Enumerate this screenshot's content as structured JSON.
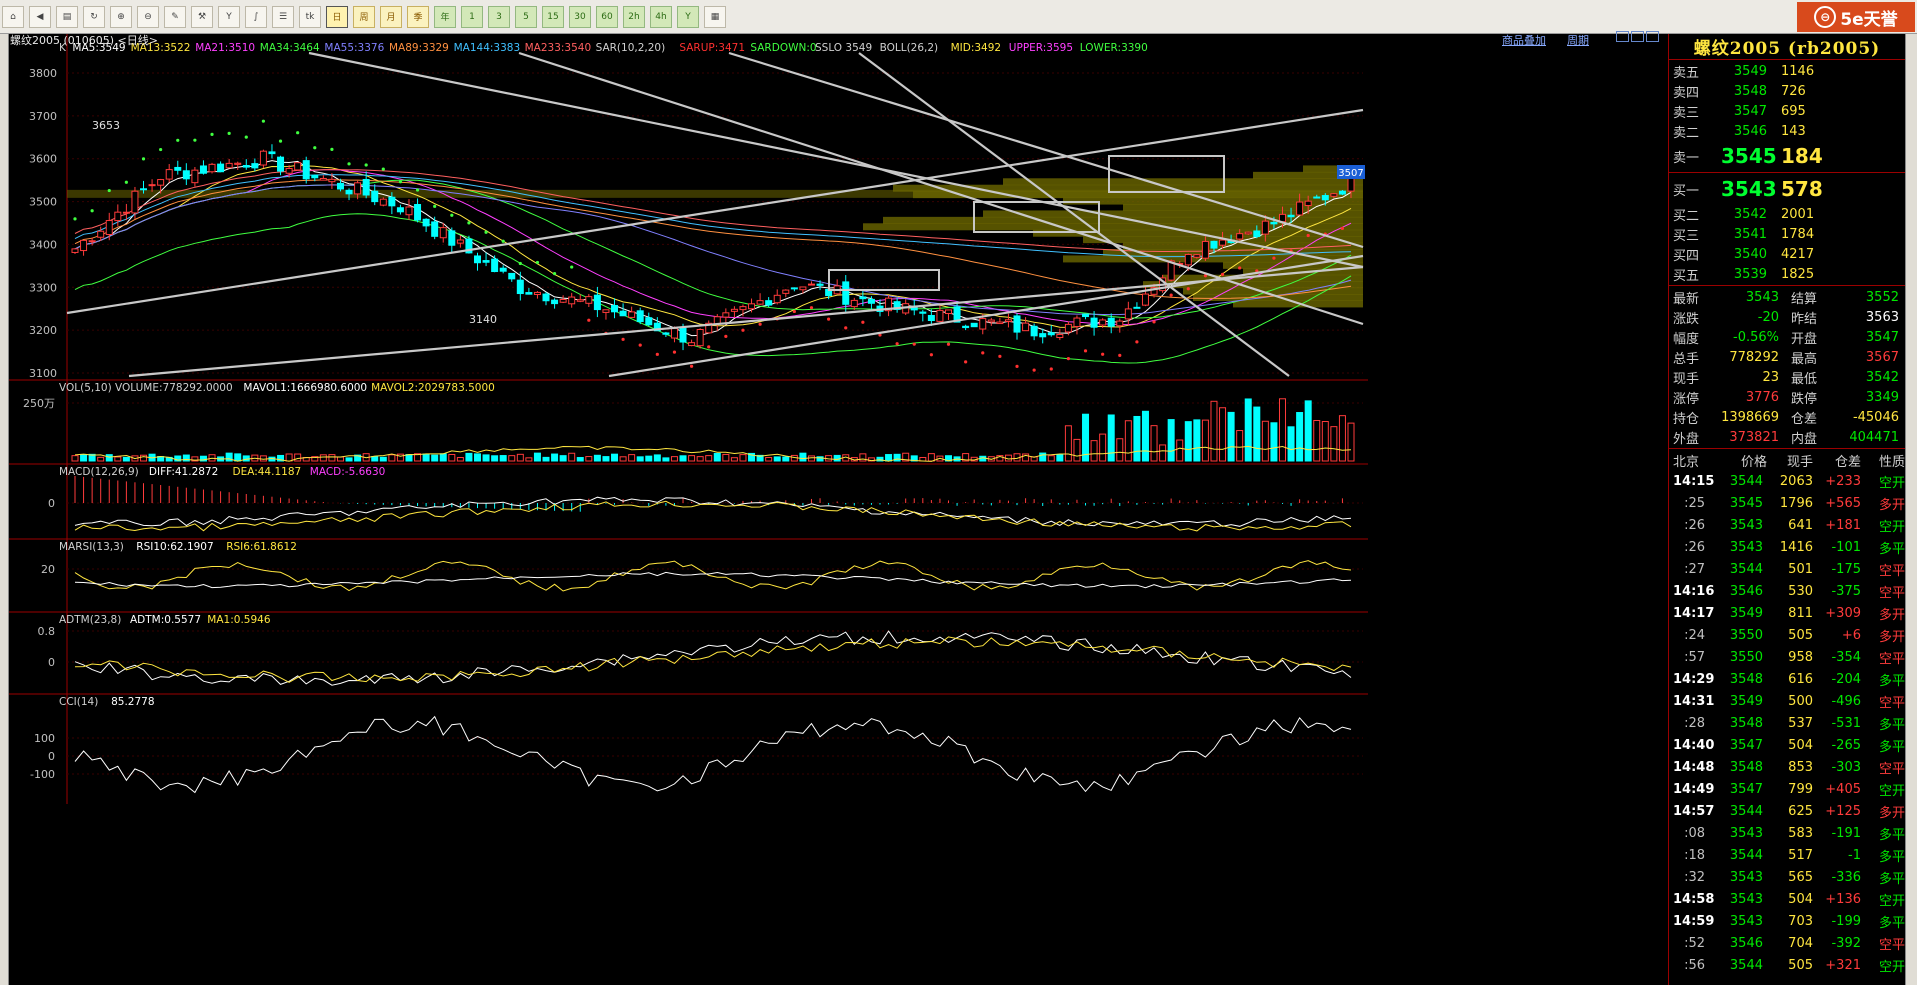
{
  "toolbar": {
    "buttons": [
      {
        "name": "home-icon",
        "glyph": "⌂"
      },
      {
        "name": "back-icon",
        "glyph": "◀"
      },
      {
        "name": "news-icon",
        "glyph": "▤"
      },
      {
        "name": "refresh-icon",
        "glyph": "↻"
      },
      {
        "name": "zoom-in-icon",
        "glyph": "⊕"
      },
      {
        "name": "zoom-out-icon",
        "glyph": "⊖"
      },
      {
        "name": "draw-icon",
        "glyph": "✎"
      },
      {
        "name": "tools-icon",
        "glyph": "⚒"
      },
      {
        "name": "indicator-icon",
        "glyph": "Y"
      },
      {
        "name": "formula-icon",
        "glyph": "∫"
      },
      {
        "name": "list-icon",
        "glyph": "☰"
      },
      {
        "name": "tick-chart-icon",
        "glyph": "tk"
      }
    ],
    "periods": [
      "日",
      "周",
      "月",
      "季",
      "年",
      "1",
      "3",
      "5",
      "15",
      "30",
      "60",
      "2h",
      "4h",
      "Y"
    ],
    "selected_period": "日",
    "logo_text": "5e天誉"
  },
  "window": {
    "title": "螺纹2005 (010605) <日线>",
    "links": [
      "商品叠加",
      "周期"
    ]
  },
  "main_chart": {
    "legend": [
      {
        "text": "K",
        "color": "#d0d0d0"
      },
      {
        "text": "MA5:3549",
        "color": "#ffffff"
      },
      {
        "text": "MA13:3522",
        "color": "#ffe640"
      },
      {
        "text": "MA21:3510",
        "color": "#ff40ff"
      },
      {
        "text": "MA34:3464",
        "color": "#40ff40"
      },
      {
        "text": "MA55:3376",
        "color": "#8080ff"
      },
      {
        "text": "MA89:3329",
        "color": "#ff9040"
      },
      {
        "text": "MA144:3383",
        "color": "#40c0ff"
      },
      {
        "text": "MA233:3540",
        "color": "#ff6060"
      },
      {
        "text": "SAR(10,2,20)",
        "color": "#d0d0d0"
      },
      {
        "text": "SARUP:3471",
        "color": "#ff3030"
      },
      {
        "text": "SARDOWN:0",
        "color": "#40ff40"
      },
      {
        "text": "SSLO 3549",
        "color": "#d0d0d0"
      },
      {
        "text": "BOLL(26,2)",
        "color": "#d0d0d0"
      },
      {
        "text": "MID:3492",
        "color": "#ffe640"
      },
      {
        "text": "UPPER:3595",
        "color": "#ff40ff"
      },
      {
        "text": "LOWER:3390",
        "color": "#40ff40"
      }
    ],
    "y_ticks": [
      "3800",
      "3700",
      "3600",
      "3500",
      "3400",
      "3300",
      "3200",
      "3100"
    ],
    "annotations": {
      "high": "3653",
      "low": "3140",
      "price_flag": "3507"
    }
  },
  "panels": [
    {
      "id": "vol",
      "legend": [
        {
          "text": "VOL(5,10) VOLUME:778292.0000",
          "color": "#d0d0d0"
        },
        {
          "text": "MAVOL1:1666980.6000",
          "color": "#ffffff"
        },
        {
          "text": "MAVOL2:2029783.5000",
          "color": "#ffe640"
        }
      ],
      "ticks": [
        "250万"
      ]
    },
    {
      "id": "macd",
      "legend": [
        {
          "text": "MACD(12,26,9)",
          "color": "#d0d0d0"
        },
        {
          "text": "DIFF:41.2872",
          "color": "#ffffff"
        },
        {
          "text": "DEA:44.1187",
          "color": "#ffe640"
        },
        {
          "text": "MACD:-5.6630",
          "color": "#ff40ff"
        }
      ],
      "ticks": [
        "0"
      ]
    },
    {
      "id": "rsi",
      "legend": [
        {
          "text": "MARSI(13,3)",
          "color": "#d0d0d0"
        },
        {
          "text": "RSI10:62.1907",
          "color": "#ffffff"
        },
        {
          "text": "RSI6:61.8612",
          "color": "#ffe640"
        }
      ],
      "ticks": [
        "20"
      ]
    },
    {
      "id": "adtm",
      "legend": [
        {
          "text": "ADTM(23,8)",
          "color": "#d0d0d0"
        },
        {
          "text": "ADTM:0.5577",
          "color": "#ffffff"
        },
        {
          "text": "MA1:0.5946",
          "color": "#ffe640"
        }
      ],
      "ticks": [
        "0.8",
        "0"
      ]
    },
    {
      "id": "cci",
      "legend": [
        {
          "text": "CCI(14)",
          "color": "#d0d0d0"
        },
        {
          "text": "85.2778",
          "color": "#ffffff"
        }
      ],
      "ticks": [
        "100",
        "0",
        "-100"
      ]
    }
  ],
  "quote": {
    "title": "螺纹2005 (rb2005)",
    "asks": [
      {
        "label": "卖五",
        "price": "3549",
        "vol": "1146"
      },
      {
        "label": "卖四",
        "price": "3548",
        "vol": "726"
      },
      {
        "label": "卖三",
        "price": "3547",
        "vol": "695"
      },
      {
        "label": "卖二",
        "price": "3546",
        "vol": "143"
      }
    ],
    "ask1": {
      "label": "卖一",
      "price": "3545",
      "vol": "184"
    },
    "bid1": {
      "label": "买一",
      "price": "3543",
      "vol": "578"
    },
    "bids": [
      {
        "label": "买二",
        "price": "3542",
        "vol": "2001"
      },
      {
        "label": "买三",
        "price": "3541",
        "vol": "1784"
      },
      {
        "label": "买四",
        "price": "3540",
        "vol": "4217"
      },
      {
        "label": "买五",
        "price": "3539",
        "vol": "1825"
      }
    ],
    "stats": [
      {
        "l1": "最新",
        "v1": "3543",
        "c1": "green",
        "l2": "结算",
        "v2": "3552",
        "c2": "green"
      },
      {
        "l1": "涨跌",
        "v1": "-20",
        "c1": "green",
        "l2": "昨结",
        "v2": "3563",
        "c2": "white"
      },
      {
        "l1": "幅度",
        "v1": "-0.56%",
        "c1": "green",
        "l2": "开盘",
        "v2": "3547",
        "c2": "green"
      },
      {
        "l1": "总手",
        "v1": "778292",
        "c1": "yellow",
        "l2": "最高",
        "v2": "3567",
        "c2": "red"
      },
      {
        "l1": "现手",
        "v1": "23",
        "c1": "yellow",
        "l2": "最低",
        "v2": "3542",
        "c2": "green"
      },
      {
        "l1": "涨停",
        "v1": "3776",
        "c1": "red",
        "l2": "跌停",
        "v2": "3349",
        "c2": "green"
      },
      {
        "l1": "持仓",
        "v1": "1398669",
        "c1": "yellow",
        "l2": "仓差",
        "v2": "-45046",
        "c2": "yellow"
      },
      {
        "l1": "外盘",
        "v1": "373821",
        "c1": "red",
        "l2": "内盘",
        "v2": "404471",
        "c2": "green"
      }
    ],
    "ticks_header": [
      "北京",
      "价格",
      "现手",
      "仓差",
      "性质"
    ],
    "ticks": [
      {
        "time": "14:15",
        "price": "3544",
        "vol": "2063",
        "diff": "+233",
        "nature": "空开",
        "nc": "green",
        "main": true
      },
      {
        "time": ":25",
        "price": "3545",
        "vol": "1796",
        "diff": "+565",
        "nature": "多开",
        "nc": "red",
        "main": false
      },
      {
        "time": ":26",
        "price": "3543",
        "vol": "641",
        "diff": "+181",
        "nature": "空开",
        "nc": "green",
        "main": false
      },
      {
        "time": ":26",
        "price": "3543",
        "vol": "1416",
        "diff": "-101",
        "nature": "多平",
        "nc": "green",
        "main": false
      },
      {
        "time": ":27",
        "price": "3544",
        "vol": "501",
        "diff": "-175",
        "nature": "空平",
        "nc": "red",
        "main": false
      },
      {
        "time": "14:16",
        "price": "3546",
        "vol": "530",
        "diff": "-375",
        "nature": "空平",
        "nc": "red",
        "main": true
      },
      {
        "time": "14:17",
        "price": "3549",
        "vol": "811",
        "diff": "+309",
        "nature": "多开",
        "nc": "red",
        "main": true
      },
      {
        "time": ":24",
        "price": "3550",
        "vol": "505",
        "diff": "+6",
        "nature": "多开",
        "nc": "red",
        "main": false
      },
      {
        "time": ":57",
        "price": "3550",
        "vol": "958",
        "diff": "-354",
        "nature": "空平",
        "nc": "red",
        "main": false
      },
      {
        "time": "14:29",
        "price": "3548",
        "vol": "616",
        "diff": "-204",
        "nature": "多平",
        "nc": "green",
        "main": true
      },
      {
        "time": "14:31",
        "price": "3549",
        "vol": "500",
        "diff": "-496",
        "nature": "空平",
        "nc": "red",
        "main": true
      },
      {
        "time": ":28",
        "price": "3548",
        "vol": "537",
        "diff": "-531",
        "nature": "多平",
        "nc": "green",
        "main": false
      },
      {
        "time": "14:40",
        "price": "3547",
        "vol": "504",
        "diff": "-265",
        "nature": "多平",
        "nc": "green",
        "main": true
      },
      {
        "time": "14:48",
        "price": "3548",
        "vol": "853",
        "diff": "-303",
        "nature": "空平",
        "nc": "red",
        "main": true
      },
      {
        "time": "14:49",
        "price": "3547",
        "vol": "799",
        "diff": "+405",
        "nature": "空开",
        "nc": "green",
        "main": true
      },
      {
        "time": "14:57",
        "price": "3544",
        "vol": "625",
        "diff": "+125",
        "nature": "多开",
        "nc": "red",
        "main": true
      },
      {
        "time": ":08",
        "price": "3543",
        "vol": "583",
        "diff": "-191",
        "nature": "多平",
        "nc": "green",
        "main": false
      },
      {
        "time": ":18",
        "price": "3544",
        "vol": "517",
        "diff": "-1",
        "nature": "多平",
        "nc": "green",
        "main": false
      },
      {
        "time": ":32",
        "price": "3543",
        "vol": "565",
        "diff": "-336",
        "nature": "多平",
        "nc": "green",
        "main": false
      },
      {
        "time": "14:58",
        "price": "3543",
        "vol": "504",
        "diff": "+136",
        "nature": "空开",
        "nc": "green",
        "main": true
      },
      {
        "time": "14:59",
        "price": "3543",
        "vol": "703",
        "diff": "-199",
        "nature": "多平",
        "nc": "green",
        "main": true
      },
      {
        "time": ":52",
        "price": "3546",
        "vol": "704",
        "diff": "-392",
        "nature": "空平",
        "nc": "red",
        "main": false
      },
      {
        "time": ":56",
        "price": "3544",
        "vol": "505",
        "diff": "+321",
        "nature": "空开",
        "nc": "green",
        "main": false
      }
    ]
  },
  "colors": {
    "up": "#ff3b3b",
    "down": "#00ffff",
    "frame": "#9b0000",
    "text": "#c0c0c0"
  }
}
